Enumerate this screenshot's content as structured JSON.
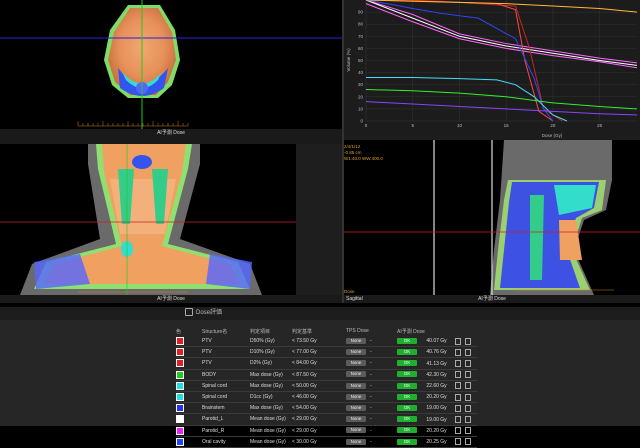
{
  "panels": {
    "axial_label": "AI予測 Dose",
    "coronal_label": "AI予測 Dose",
    "sagittal_label": "AI予測 Dose",
    "sagittal_overlay": [
      "2/4/1/12",
      "-0.85 cm",
      "W1:40.0 WW:400.0"
    ],
    "sagittal_bottom_left": "Dose",
    "sagittal_bottom_title": "Sagittal"
  },
  "chart_data": {
    "type": "line",
    "xlabel": "Dose (Gy)",
    "ylabel": "Volume (%)",
    "x_ticks": [
      0,
      5,
      10,
      15,
      20,
      25
    ],
    "y_ticks": [
      0,
      10,
      20,
      30,
      40,
      50,
      60,
      70,
      80,
      90
    ],
    "xlim": [
      0,
      29
    ],
    "ylim": [
      0,
      100
    ],
    "series": [
      {
        "color": "#ff66ff",
        "x": [
          0,
          5,
          10,
          15,
          20,
          25,
          29
        ],
        "y": [
          100,
          88,
          72,
          64,
          58,
          52,
          48
        ]
      },
      {
        "color": "#ffffff",
        "x": [
          0,
          5,
          10,
          15,
          20,
          25,
          29
        ],
        "y": [
          100,
          85,
          70,
          62,
          56,
          50,
          46
        ]
      },
      {
        "color": "#ff66ff",
        "x": [
          0,
          5,
          10,
          15,
          20,
          25,
          29
        ],
        "y": [
          97,
          82,
          68,
          60,
          54,
          49,
          44
        ]
      },
      {
        "color": "#cc2222",
        "x": [
          0,
          4,
          8,
          12,
          16,
          17.5,
          19,
          21
        ],
        "y": [
          100,
          100,
          99,
          97,
          95,
          60,
          10,
          0
        ]
      },
      {
        "color": "#ff4444",
        "x": [
          0,
          6,
          10,
          14,
          16,
          17,
          18.5,
          20
        ],
        "y": [
          100,
          99,
          98,
          97,
          92,
          50,
          8,
          0
        ]
      },
      {
        "color": "#3344ff",
        "x": [
          0,
          3,
          5,
          8,
          12,
          16,
          18,
          19,
          20
        ],
        "y": [
          100,
          96,
          93,
          89,
          85,
          68,
          35,
          10,
          0
        ]
      },
      {
        "color": "#ffbb33",
        "x": [
          0,
          5,
          10,
          15,
          20,
          25,
          29
        ],
        "y": [
          100,
          99,
          98,
          97,
          95,
          93,
          90
        ]
      },
      {
        "color": "#44ddff",
        "x": [
          0,
          5,
          10,
          14,
          16,
          18,
          20,
          21.5
        ],
        "y": [
          36,
          36,
          35,
          34,
          30,
          20,
          5,
          0
        ]
      },
      {
        "color": "#33ee33",
        "x": [
          0,
          5,
          10,
          15,
          20,
          25,
          29
        ],
        "y": [
          26,
          25,
          23,
          20,
          15,
          12,
          10
        ]
      },
      {
        "color": "#8844ff",
        "x": [
          0,
          5,
          10,
          15,
          20,
          25,
          29
        ],
        "y": [
          16,
          14,
          12,
          10,
          8,
          6,
          5
        ]
      }
    ]
  },
  "dose_panel": {
    "title": "Dose評価",
    "headers": [
      "色",
      "Structure名",
      "判定項目",
      "判定基準",
      "TPS Dose",
      "",
      "AI予測 Dose",
      ""
    ],
    "rows": [
      {
        "color": "#e02020",
        "structure": "PTV",
        "item": "D50% (Gy)",
        "criterion": "< 73.50 Gy",
        "tps": "None",
        "dash": "-",
        "status": "OK",
        "ai": "40.07 Gy"
      },
      {
        "color": "#e02020",
        "structure": "PTV",
        "item": "D10% (Gy)",
        "criterion": "< 77.00 Gy",
        "tps": "None",
        "dash": "-",
        "status": "OK",
        "ai": "40.76 Gy"
      },
      {
        "color": "#e02020",
        "structure": "PTV",
        "item": "D2% (Gy)",
        "criterion": "< 84.00 Gy",
        "tps": "None",
        "dash": "-",
        "status": "OK",
        "ai": "41.13 Gy"
      },
      {
        "color": "#22cc22",
        "structure": "BODY",
        "item": "Max dose (Gy)",
        "criterion": "< 87.50 Gy",
        "tps": "None",
        "dash": "-",
        "status": "OK",
        "ai": "42.30 Gy"
      },
      {
        "color": "#22dddd",
        "structure": "Spinal cord",
        "item": "Max dose (Gy)",
        "criterion": "< 50.00 Gy",
        "tps": "None",
        "dash": "-",
        "status": "OK",
        "ai": "22.60 Gy"
      },
      {
        "color": "#22dddd",
        "structure": "Spinal cord",
        "item": "D1cc (Gy)",
        "criterion": "< 46.00 Gy",
        "tps": "None",
        "dash": "-",
        "status": "OK",
        "ai": "20.20 Gy"
      },
      {
        "color": "#2233ee",
        "structure": "Brainstem",
        "item": "Max dose (Gy)",
        "criterion": "< 54.00 Gy",
        "tps": "None",
        "dash": "-",
        "status": "OK",
        "ai": "19.00 Gy"
      },
      {
        "color": "#ffffff",
        "structure": "Parotid_L",
        "item": "Mean dose (Gy)",
        "criterion": "< 29.00 Gy",
        "tps": "None",
        "dash": "-",
        "status": "OK",
        "ai": "19.00 Gy"
      },
      {
        "color": "#ee22ee",
        "structure": "Parotid_R",
        "item": "Mean dose (Gy)",
        "criterion": "< 29.00 Gy",
        "tps": "None",
        "dash": "-",
        "status": "OK",
        "ai": "20.20 Gy"
      },
      {
        "color": "#2244ff",
        "structure": "Oral cavity",
        "item": "Mean dose (Gy)",
        "criterion": "< 30.00 Gy",
        "tps": "None",
        "dash": "-",
        "status": "OK",
        "ai": "20.25 Gy"
      }
    ]
  }
}
